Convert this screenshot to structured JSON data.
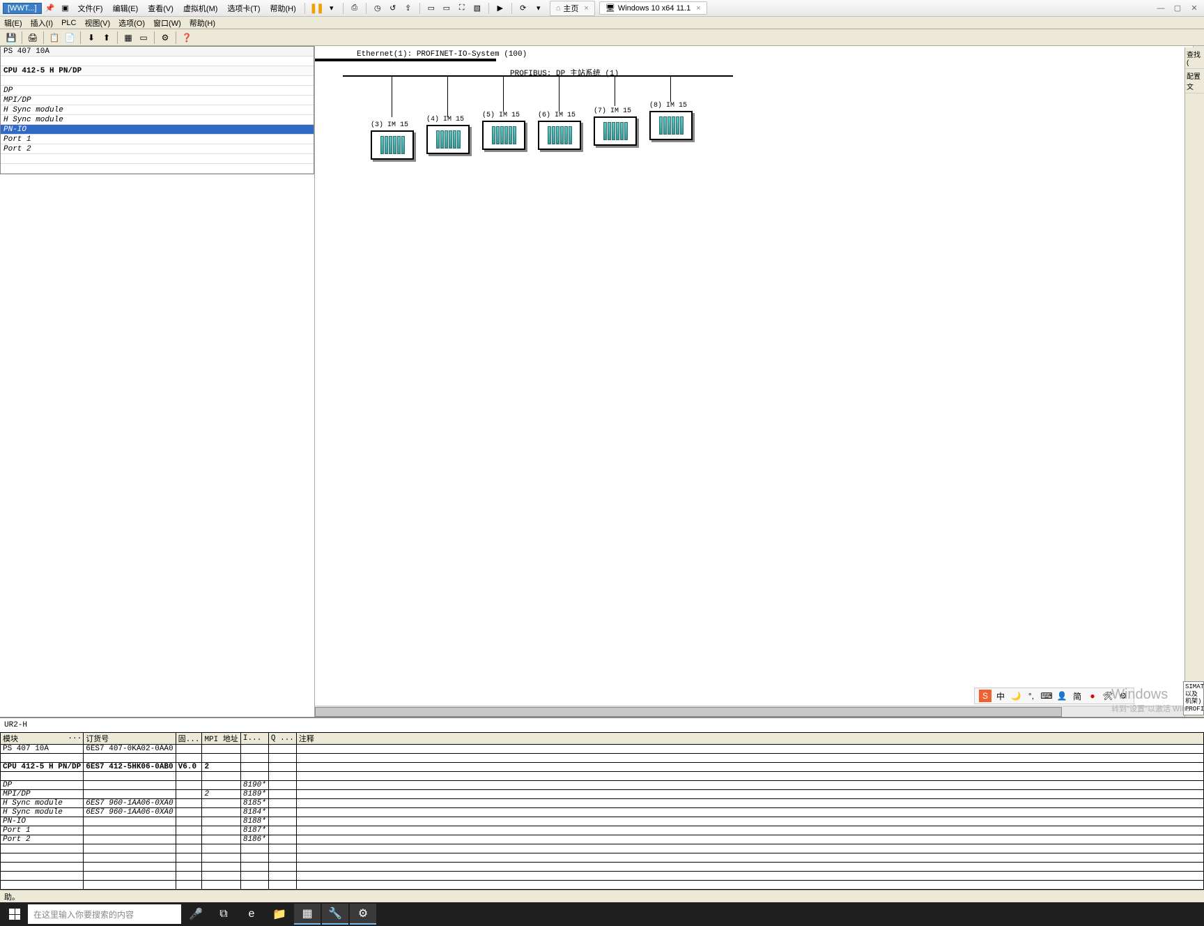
{
  "vmware": {
    "title": "[WWT...]",
    "menu": [
      "文件(F)",
      "编辑(E)",
      "查看(V)",
      "虚拟机(M)",
      "选项卡(T)",
      "帮助(H)"
    ],
    "tabs": {
      "home": "主页",
      "vm": "Windows 10 x64 11.1"
    }
  },
  "submenu": [
    "辑(E)",
    "插入(I)",
    "PLC",
    "视图(V)",
    "选项(O)",
    "窗口(W)",
    "帮助(H)"
  ],
  "rack": {
    "ps": "PS 407 10A",
    "cpu": "CPU 412-5 H PN/DP",
    "items": [
      "DP",
      "MPI/DP",
      "H Sync module",
      "H Sync module",
      "PN-IO",
      "Port 1",
      "Port 2"
    ]
  },
  "diagram": {
    "ethernet_label": "Ethernet(1): PROFINET-IO-System (100)",
    "profibus_label": "PROFIBUS: DP 主站系统 (1)",
    "nodes": [
      {
        "id": "(3) IM 15"
      },
      {
        "id": "(4) IM 15"
      },
      {
        "id": "(5) IM 15"
      },
      {
        "id": "(6) IM 15"
      },
      {
        "id": "(7) IM 15"
      },
      {
        "id": "(8) IM 15"
      }
    ]
  },
  "table": {
    "title": "UR2-H",
    "headers": {
      "module": "模块",
      "order": "订货号",
      "fw": "固...",
      "mpi": "MPI 地址",
      "i": "I...",
      "q": "Q ...",
      "comment": "注释"
    },
    "rows": [
      {
        "module": "PS 407 10A",
        "order": "6ES7 407-0KA02-0AA0",
        "fw": "",
        "mpi": "",
        "i": "",
        "q": ""
      },
      {
        "module": "",
        "order": "",
        "fw": "",
        "mpi": "",
        "i": "",
        "q": ""
      },
      {
        "module": "CPU 412-5 H PN/DP",
        "order": "6ES7 412-5HK06-0AB0",
        "fw": "V6.0",
        "mpi": "2",
        "i": "",
        "q": "",
        "bold": true
      },
      {
        "module": "",
        "order": "",
        "fw": "",
        "mpi": "",
        "i": "",
        "q": ""
      },
      {
        "module": "DP",
        "order": "",
        "fw": "",
        "mpi": "",
        "i": "8190*",
        "q": "",
        "it": true
      },
      {
        "module": "MPI/DP",
        "order": "",
        "fw": "",
        "mpi": "2",
        "i": "8189*",
        "q": "",
        "it": true
      },
      {
        "module": "H Sync module",
        "order": "6ES7 960-1AA06-0XA0",
        "fw": "",
        "mpi": "",
        "i": "8185*",
        "q": "",
        "it": true
      },
      {
        "module": "H Sync module",
        "order": "6ES7 960-1AA06-0XA0",
        "fw": "",
        "mpi": "",
        "i": "8184*",
        "q": "",
        "it": true
      },
      {
        "module": "PN-IO",
        "order": "",
        "fw": "",
        "mpi": "",
        "i": "8188*",
        "q": "",
        "it": true
      },
      {
        "module": "Port 1",
        "order": "",
        "fw": "",
        "mpi": "",
        "i": "8187*",
        "q": "",
        "it": true
      },
      {
        "module": "Port 2",
        "order": "",
        "fw": "",
        "mpi": "",
        "i": "8186*",
        "q": "",
        "it": true
      },
      {
        "module": "",
        "order": "",
        "fw": "",
        "mpi": "",
        "i": "",
        "q": ""
      },
      {
        "module": "",
        "order": "",
        "fw": "",
        "mpi": "",
        "i": "",
        "q": ""
      },
      {
        "module": "",
        "order": "",
        "fw": "",
        "mpi": "",
        "i": "",
        "q": ""
      },
      {
        "module": "",
        "order": "",
        "fw": "",
        "mpi": "",
        "i": "",
        "q": ""
      },
      {
        "module": "",
        "order": "",
        "fw": "",
        "mpi": "",
        "i": "",
        "q": ""
      }
    ]
  },
  "status": "助。",
  "taskbar": {
    "search_placeholder": "在这里输入你要搜索的内容"
  },
  "right": {
    "find": "查找(",
    "config": "配置文"
  },
  "watermark": {
    "main": "Windows",
    "sub": "转到\"设置\"以激活 Wind"
  },
  "rightbox": [
    "SIMAT",
    "以及",
    "机架)",
    "PROFI"
  ],
  "ime": {
    "lang": "中",
    "simp": "简"
  }
}
